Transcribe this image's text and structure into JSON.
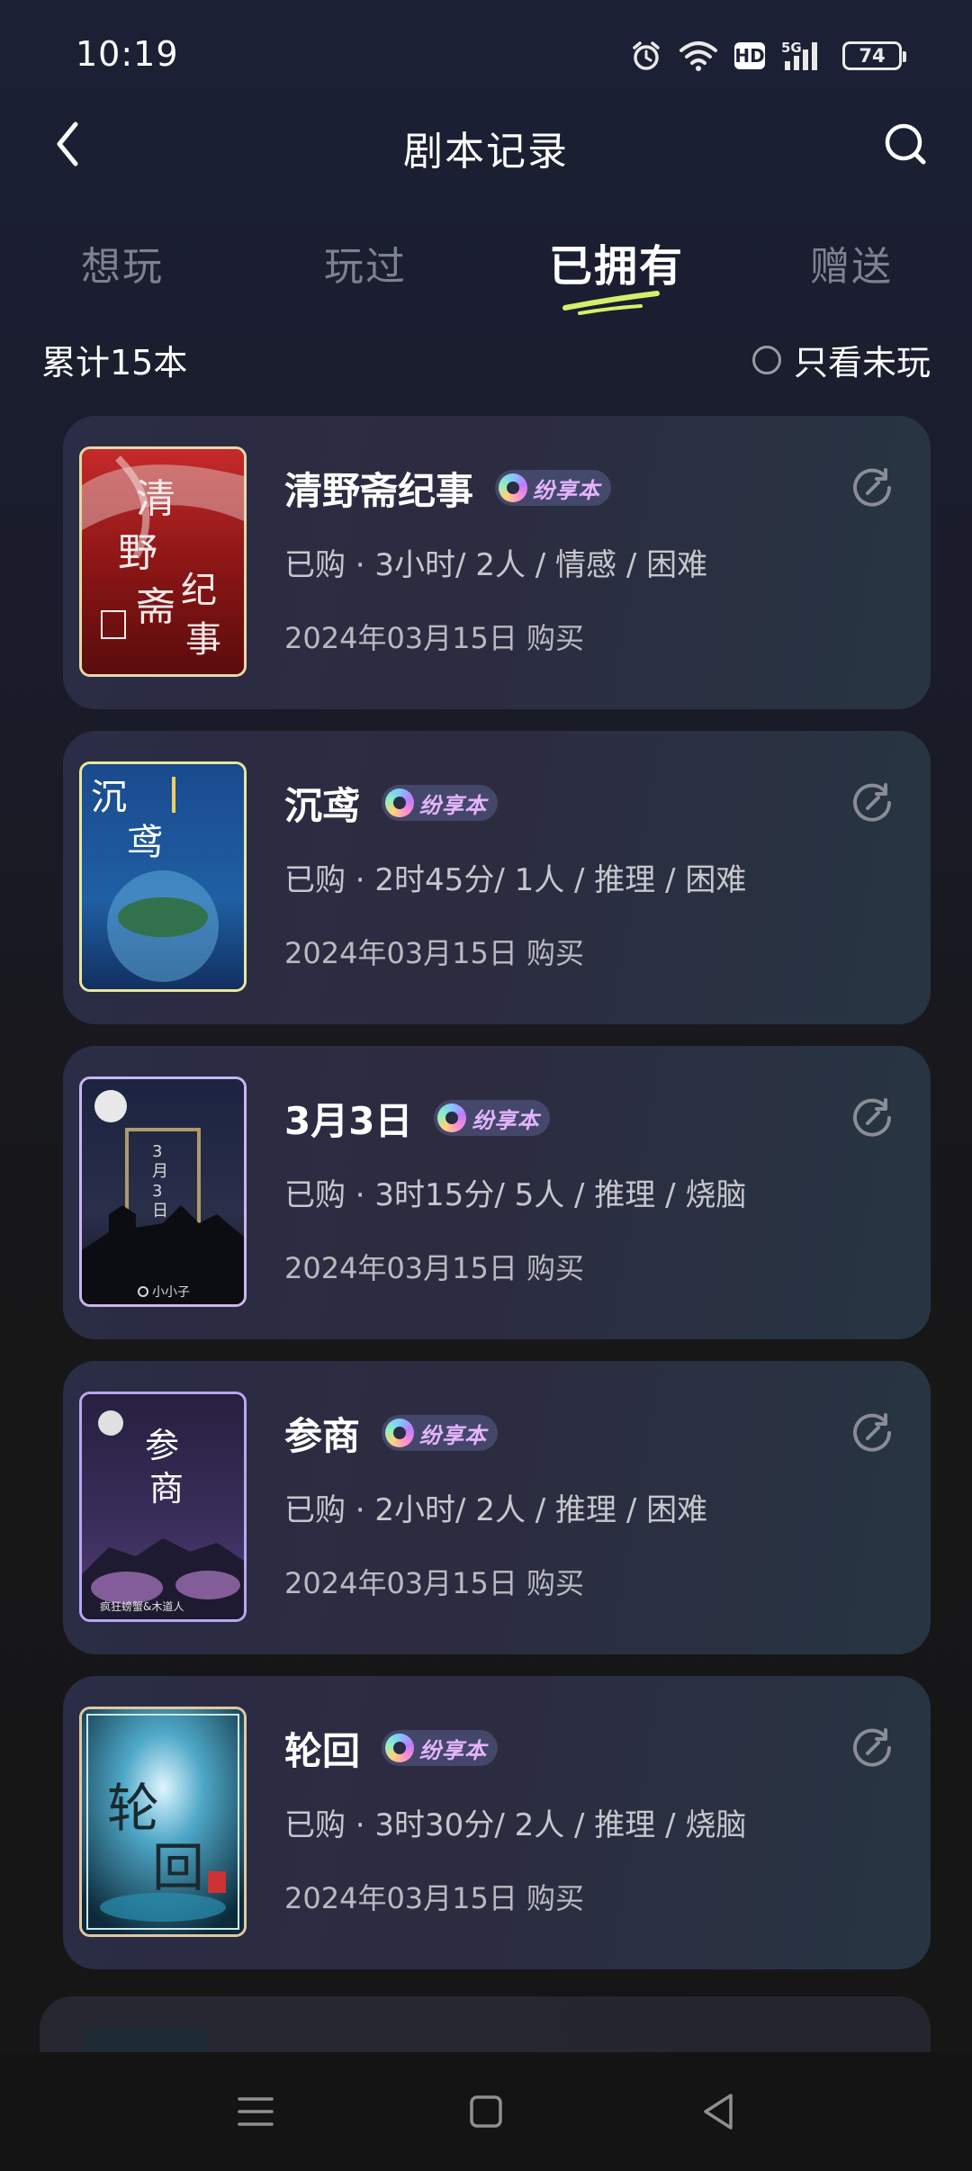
{
  "status_bar": {
    "time": "10:19",
    "network": "5G",
    "hd": "HD",
    "battery": "74"
  },
  "header": {
    "title": "剧本记录",
    "back_icon": "back-arrow-icon",
    "search_icon": "search-icon"
  },
  "tabs": [
    {
      "label": "想玩",
      "active": false
    },
    {
      "label": "玩过",
      "active": false
    },
    {
      "label": "已拥有",
      "active": true
    },
    {
      "label": "赠送",
      "active": false
    }
  ],
  "summary": {
    "count_text": "累计15本",
    "filter_label": "只看未玩"
  },
  "badge_label": "纷享本",
  "scripts": [
    {
      "title": "清野斋纪事",
      "meta": "已购 · 3小时/ 2人 / 情感 / 困难",
      "date": "2024年03月15日 购买",
      "cover_text": "清野斋纪事"
    },
    {
      "title": "沉鸢",
      "meta": "已购 · 2时45分/ 1人 / 推理 / 困难",
      "date": "2024年03月15日 购买",
      "cover_text": "沉鸢"
    },
    {
      "title": "3月3日",
      "meta": "已购 · 3时15分/ 5人 / 推理 / 烧脑",
      "date": "2024年03月15日 购买",
      "cover_text": "3月3日",
      "cover_author": "小小子"
    },
    {
      "title": "参商",
      "meta": "已购 · 2小时/ 2人 / 推理 / 困难",
      "date": "2024年03月15日 购买",
      "cover_text": "参商",
      "cover_author": "疯狂螃蟹&木道人"
    },
    {
      "title": "轮回",
      "meta": "已购 · 3时30分/ 2人 / 推理 / 烧脑",
      "date": "2024年03月15日 购买",
      "cover_text": "轮回"
    }
  ],
  "colors": {
    "background_top": "#1b2035",
    "background_bottom": "#161616",
    "card": "#2a2d45",
    "tab_inactive": "#7d8290",
    "tab_underline": "#d4ef6a",
    "badge_text": "#e4b5ff"
  },
  "nav_bar": {
    "menu_icon": "menu-icon",
    "home_icon": "home-square-icon",
    "back_icon": "back-triangle-icon"
  }
}
